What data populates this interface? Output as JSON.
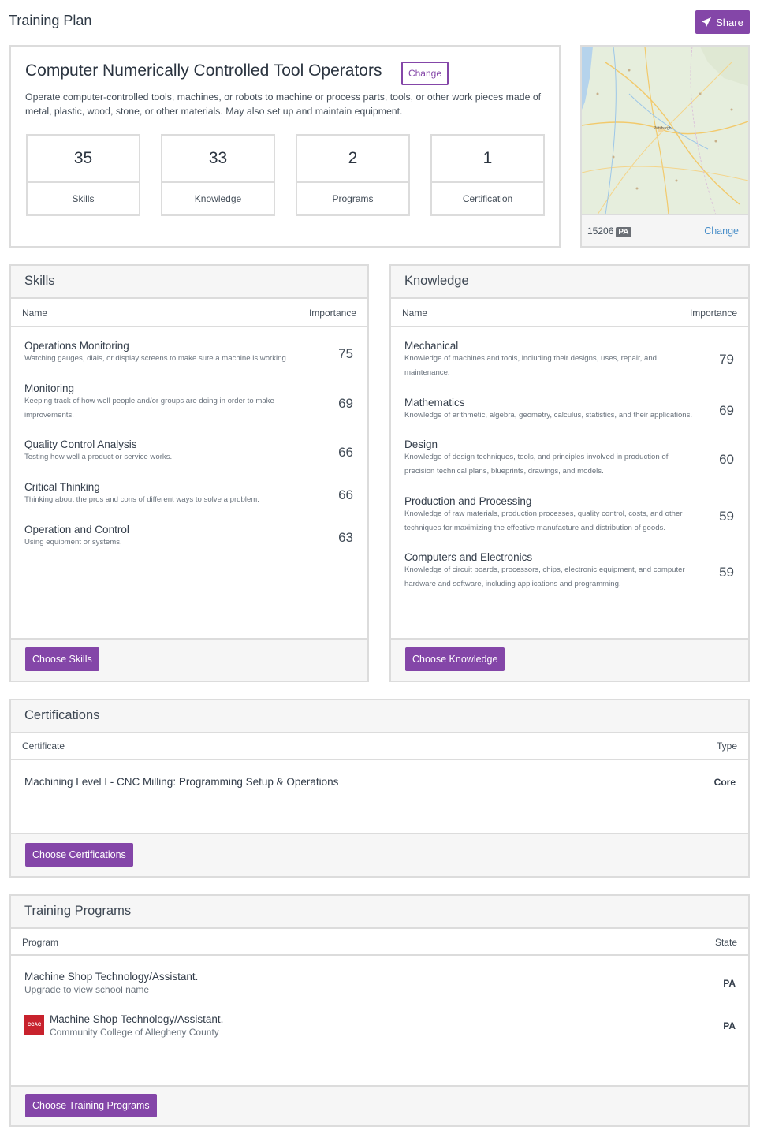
{
  "header": {
    "title": "Training Plan",
    "share_label": "Share"
  },
  "occupation": {
    "title": "Computer Numerically Controlled Tool Operators",
    "change_label": "Change",
    "description": "Operate computer-controlled tools, machines, or robots to machine or process parts, tools, or other work pieces made of metal, plastic, wood, stone, or other materials. May also set up and maintain equipment.",
    "stats": [
      {
        "value": "35",
        "label": "Skills"
      },
      {
        "value": "33",
        "label": "Knowledge"
      },
      {
        "value": "2",
        "label": "Programs"
      },
      {
        "value": "1",
        "label": "Certification"
      }
    ]
  },
  "location": {
    "zip": "15206",
    "state": "PA",
    "change_label": "Change",
    "map_city": "Pittsburgh"
  },
  "skills": {
    "title": "Skills",
    "col_name": "Name",
    "col_importance": "Importance",
    "items": [
      {
        "name": "Operations Monitoring",
        "desc": "Watching gauges, dials, or display screens to make sure a machine is working.",
        "value": "75"
      },
      {
        "name": "Monitoring",
        "desc": "Keeping track of how well people and/or groups are doing in order to make improvements.",
        "value": "69"
      },
      {
        "name": "Quality Control Analysis",
        "desc": "Testing how well a product or service works.",
        "value": "66"
      },
      {
        "name": "Critical Thinking",
        "desc": "Thinking about the pros and cons of different ways to solve a problem.",
        "value": "66"
      },
      {
        "name": "Operation and Control",
        "desc": "Using equipment or systems.",
        "value": "63"
      }
    ],
    "button_label": "Choose Skills"
  },
  "knowledge": {
    "title": "Knowledge",
    "col_name": "Name",
    "col_importance": "Importance",
    "items": [
      {
        "name": "Mechanical",
        "desc": "Knowledge of machines and tools, including their designs, uses, repair, and maintenance.",
        "value": "79"
      },
      {
        "name": "Mathematics",
        "desc": "Knowledge of arithmetic, algebra, geometry, calculus, statistics, and their applications.",
        "value": "69"
      },
      {
        "name": "Design",
        "desc": "Knowledge of design techniques, tools, and principles involved in production of precision technical plans, blueprints, drawings, and models.",
        "value": "60"
      },
      {
        "name": "Production and Processing",
        "desc": "Knowledge of raw materials, production processes, quality control, costs, and other techniques for maximizing the effective manufacture and distribution of goods.",
        "value": "59"
      },
      {
        "name": "Computers and Electronics",
        "desc": "Knowledge of circuit boards, processors, chips, electronic equipment, and computer hardware and software, including applications and programming.",
        "value": "59"
      }
    ],
    "button_label": "Choose Knowledge"
  },
  "certifications": {
    "title": "Certifications",
    "col_name": "Certificate",
    "col_type": "Type",
    "items": [
      {
        "name": "Machining Level I - CNC Milling: Programming Setup & Operations",
        "type": "Core"
      }
    ],
    "button_label": "Choose Certifications"
  },
  "programs": {
    "title": "Training Programs",
    "col_name": "Program",
    "col_state": "State",
    "items": [
      {
        "name": "Machine Shop Technology/Assistant.",
        "school": "Upgrade to view school name",
        "state": "PA"
      },
      {
        "name": "Machine Shop Technology/Assistant.",
        "school": "Community College of Allegheny County",
        "state": "PA",
        "logo_text": "CCAC"
      }
    ],
    "button_label": "Choose Training Programs"
  }
}
